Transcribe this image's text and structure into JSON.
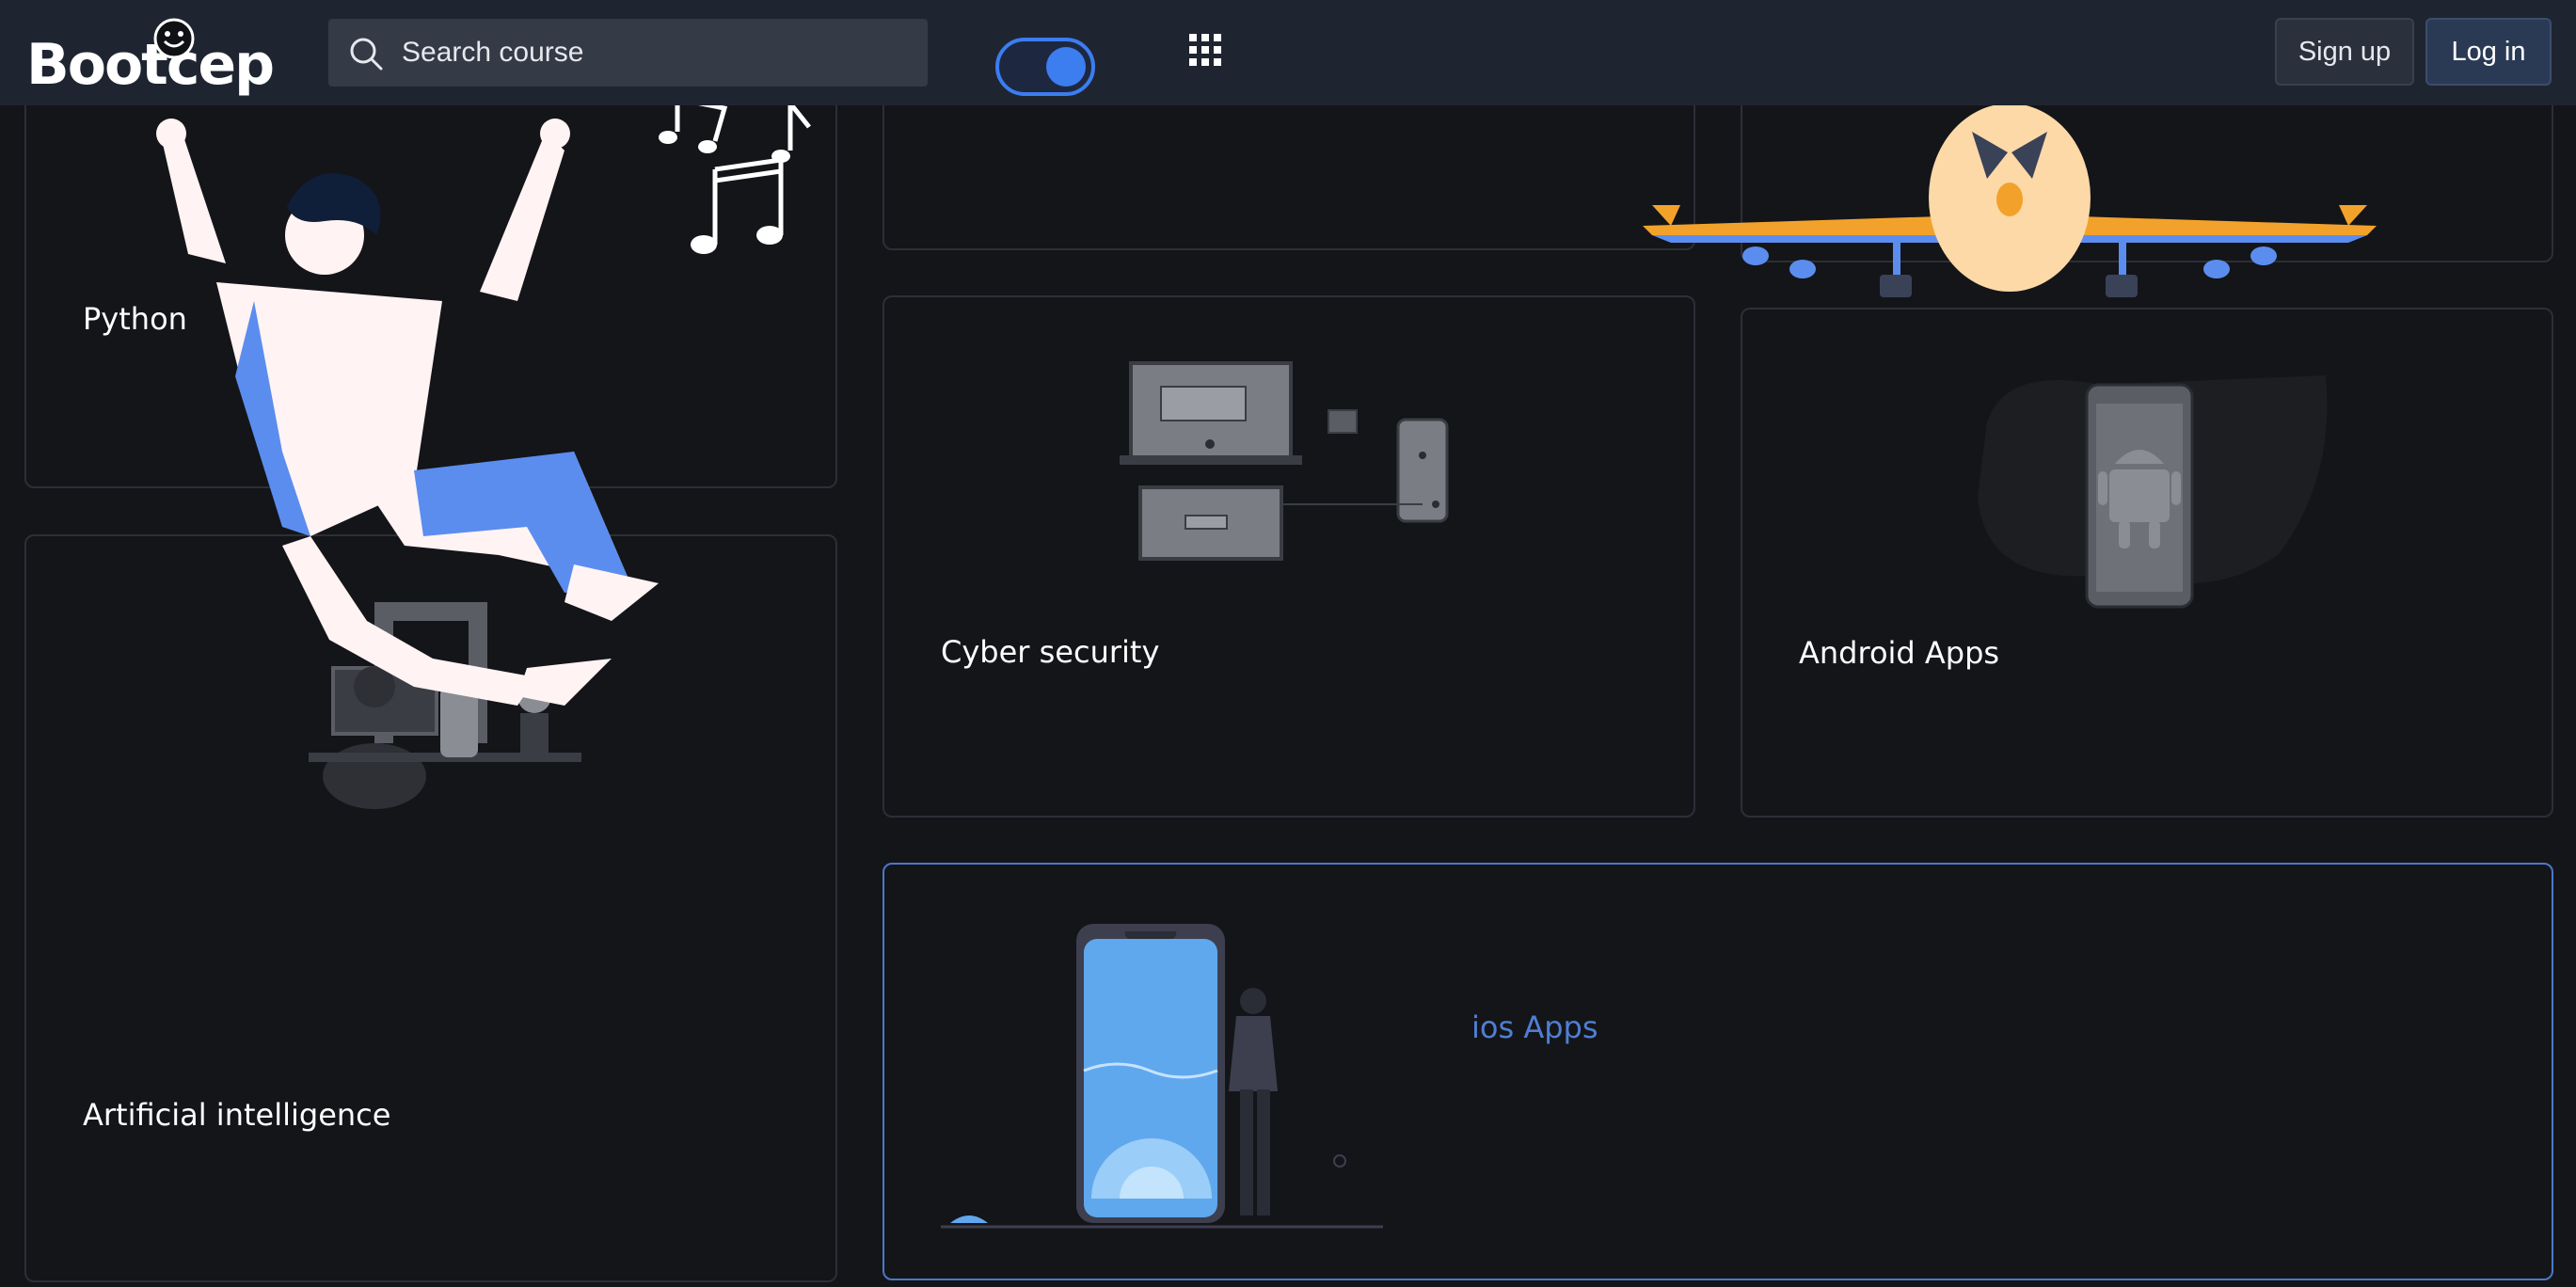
{
  "header": {
    "logo_text": "Bootсep",
    "search": {
      "placeholder": "Search course",
      "value": ""
    },
    "theme_toggle": {
      "state": "on"
    },
    "apps_icon": "grid-icon",
    "signup_label": "Sign up",
    "login_label": "Log in"
  },
  "courses": {
    "python": {
      "label": "Python"
    },
    "ai": {
      "label": "Artificial intelligence"
    },
    "cyber": {
      "label": "Cyber security"
    },
    "android": {
      "label": "Android Apps"
    },
    "ios": {
      "label": "ios Apps"
    }
  },
  "colors": {
    "topbar": "#1f2530",
    "background": "#141519",
    "accent": "#3c7df0",
    "ios_label": "#4f7fd3",
    "illustration_blue": "#5b8def",
    "airplane_orange": "#f2a22b"
  }
}
